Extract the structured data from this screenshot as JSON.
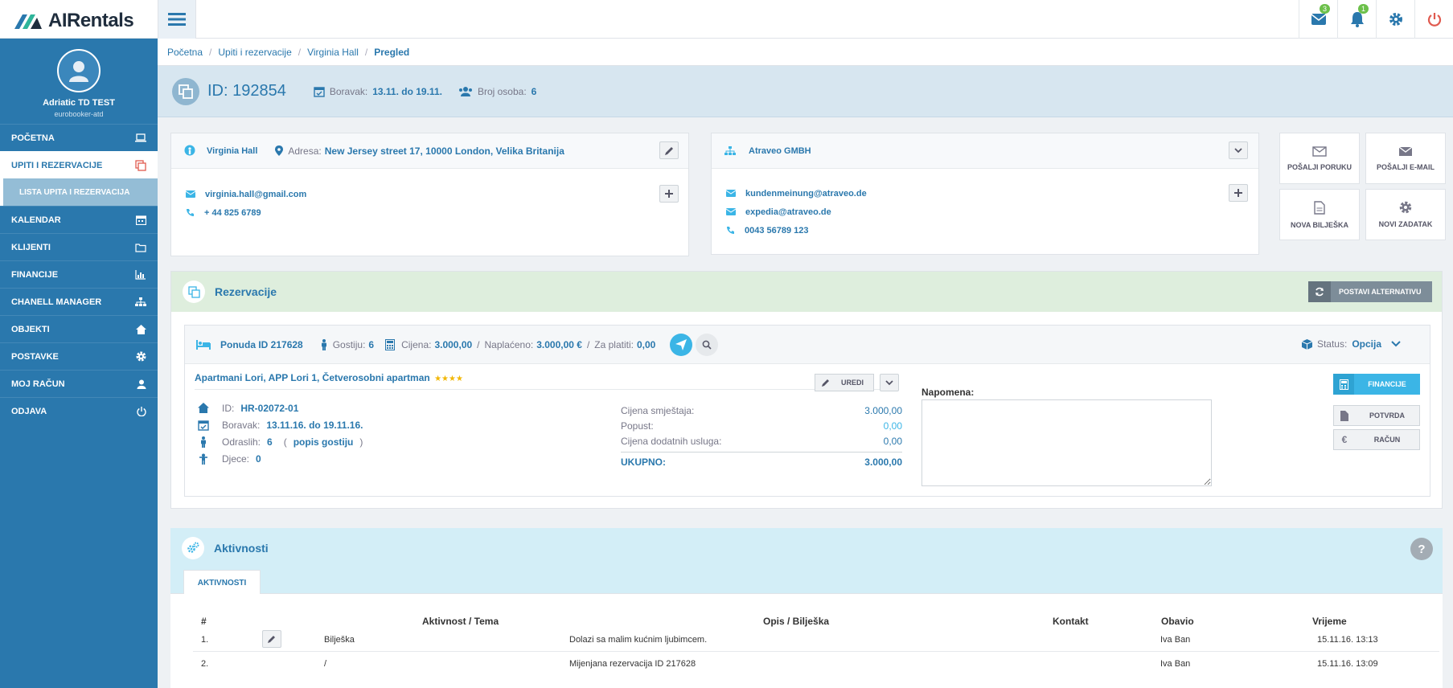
{
  "app": {
    "logo_text": "AIRentals"
  },
  "topbar": {
    "messages_badge": "3",
    "notifications_badge": "1"
  },
  "sidebar": {
    "user_name": "Adriatic TD TEST",
    "user_sub": "eurobooker-atd",
    "items": [
      {
        "label": "POČETNA"
      },
      {
        "label": "UPITI I REZERVACIJE"
      },
      {
        "label": "LISTA UPITA I REZERVACIJA"
      },
      {
        "label": "KALENDAR"
      },
      {
        "label": "KLIJENTI"
      },
      {
        "label": "FINANCIJE"
      },
      {
        "label": "CHANELL MANAGER"
      },
      {
        "label": "OBJEKTI"
      },
      {
        "label": "POSTAVKE"
      },
      {
        "label": "MOJ RAČUN"
      },
      {
        "label": "ODJAVA"
      }
    ]
  },
  "breadcrumb": [
    "Početna",
    "Upiti i rezervacije",
    "Virginia Hall",
    "Pregled"
  ],
  "header": {
    "id_text": "ID: 192854",
    "stay_label": "Boravak:",
    "stay_value": "13.11. do 19.11.",
    "persons_label": "Broj osoba:",
    "persons_value": "6"
  },
  "guest_card": {
    "name": "Virginia Hall",
    "address_label": "Adresa:",
    "address_value": "New Jersey street 17, 10000 London, Velika Britanija",
    "email": "virginia.hall@gmail.com",
    "phone": "+ 44 825 6789"
  },
  "agency_card": {
    "name": "Atraveo GMBH",
    "email1": "kundenmeinung@atraveo.de",
    "email2": "expedia@atraveo.de",
    "phone": "0043 56789 123"
  },
  "actions": {
    "send_message": "POŠALJI PORUKU",
    "send_email": "POŠALJI E-MAIL",
    "new_note": "NOVA BILJEŠKA",
    "new_task": "NOVI ZADATAK"
  },
  "reservations": {
    "title": "Rezervacije",
    "alt_button": "POSTAVI ALTERNATIVU",
    "offer": {
      "offer_id": "Ponuda ID 217628",
      "guests_label": "Gostiju:",
      "guests_value": "6",
      "price_label": "Cijena:",
      "price_value": "3.000,00",
      "paid_label": "Naplaćeno:",
      "paid_value": "3.000,00 €",
      "due_label": "Za platiti:",
      "due_value": "0,00",
      "status_label": "Status:",
      "status_value": "Opcija",
      "unit_name": "Apartmani Lori, APP Lori 1, Četverosobni apartman",
      "stars": "★★★★",
      "edit_button": "UREDI",
      "id_label": "ID:",
      "id_value": "HR-02072-01",
      "stay_label": "Boravak:",
      "stay_value": "13.11.16. do 19.11.16.",
      "adults_label": "Odraslih:",
      "adults_value": "6",
      "guest_list_link": "popis gostiju",
      "children_label": "Djece:",
      "children_value": "0",
      "accommodation_price_label": "Cijena smještaja:",
      "accommodation_price_value": "3.000,00",
      "discount_label": "Popust:",
      "discount_value": "0,00",
      "services_price_label": "Cijena dodatnih usluga:",
      "services_price_value": "0,00",
      "total_label": "UKUPNO:",
      "total_value": "3.000,00",
      "note_label": "Napomena:",
      "finance_button": "FINANCIJE",
      "confirm_button": "POTVRDA",
      "invoice_button": "RAČUN"
    }
  },
  "activities": {
    "title": "Aktivnosti",
    "tab": "AKTIVNOSTI",
    "columns": [
      "#",
      "Aktivnost / Tema",
      "Opis / Bilješka",
      "Kontakt",
      "Obavio",
      "Vrijeme"
    ],
    "rows": [
      {
        "num": "1.",
        "activity": "Bilješka",
        "desc": "Dolazi sa malim kućnim ljubimcem.",
        "contact": "",
        "done_by": "Iva Ban",
        "time": "15.11.16. 13:13"
      },
      {
        "num": "2.",
        "activity": "/",
        "desc": "Mijenjana rezervacija ID 217628",
        "contact": "",
        "done_by": "Iva Ban",
        "time": "15.11.16. 13:09"
      }
    ]
  },
  "colors": {
    "primary": "#2a78ad",
    "accent": "#3bb5e6",
    "danger": "#e05a4f",
    "badge": "#6cc04a"
  }
}
